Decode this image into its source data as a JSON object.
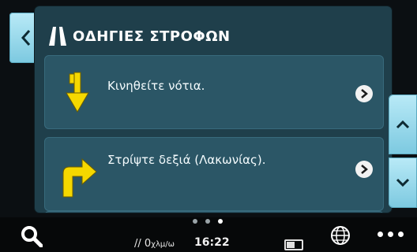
{
  "header": {
    "title": "ΟΔΗΓΙΕΣ ΣΤΡΟΦΩΝ",
    "icon": "road-icon"
  },
  "directions": [
    {
      "text": "Κινηθείτε νότια.",
      "icon": "arrow-down-icon"
    },
    {
      "text": "Στρίψτε δεξιά (Λακωνίας).",
      "icon": "turn-right-icon"
    }
  ],
  "status": {
    "speed_value": "0",
    "speed_unit": "χλμ/ω",
    "time": "16:22"
  },
  "page_dots": {
    "count": 3,
    "active": 3
  },
  "colors": {
    "panel": "#1f3f4b",
    "item": "#2b5666",
    "side_button": "#9ad8ea",
    "arrow": "#f5d800"
  }
}
